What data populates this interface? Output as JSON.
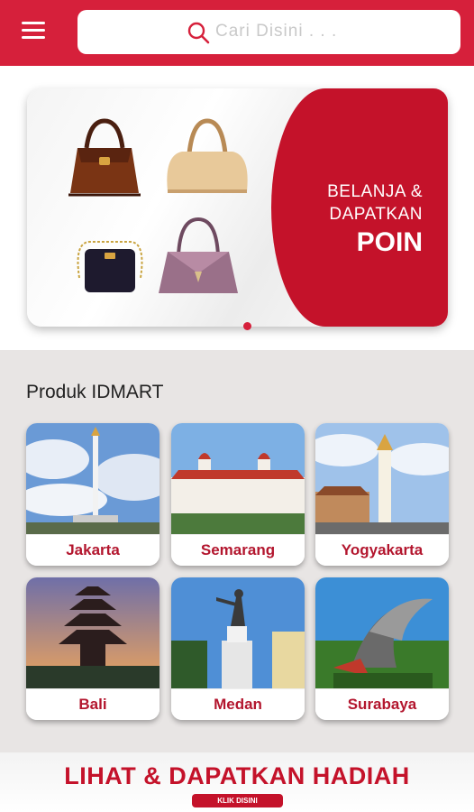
{
  "header": {
    "search_placeholder": "Cari Disini . . .",
    "icons": {
      "menu": "hamburger-menu-icon",
      "search": "search-icon"
    },
    "color": "#d6203b"
  },
  "banner": {
    "line1": "BELANJA &",
    "line2": "DAPATKAN",
    "line3": "POIN",
    "accent_color": "#c4122a",
    "slides_total": 1,
    "active_slide": 1
  },
  "products": {
    "title": "Produk IDMART",
    "cities": [
      {
        "label": "Jakarta"
      },
      {
        "label": "Semarang"
      },
      {
        "label": "Yogyakarta"
      },
      {
        "label": "Bali"
      },
      {
        "label": "Medan"
      },
      {
        "label": "Surabaya"
      }
    ]
  },
  "promo": {
    "title": "LIHAT & DAPATKAN HADIAH",
    "button": "KLIK DISINI"
  }
}
